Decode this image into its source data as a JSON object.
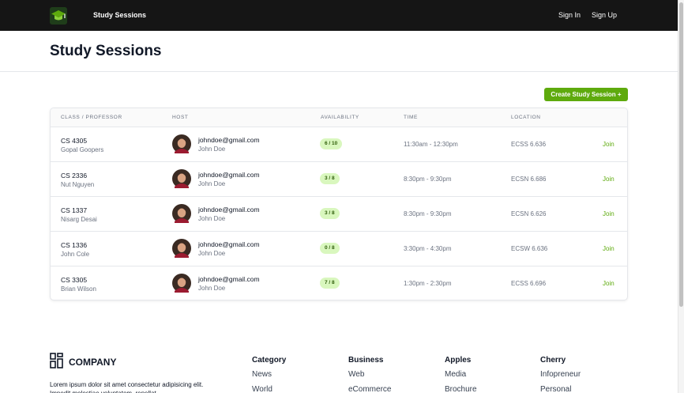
{
  "nav": {
    "brand": "Study Sessions",
    "sign_in": "Sign In",
    "sign_up": "Sign Up"
  },
  "header": {
    "title": "Study Sessions"
  },
  "actions": {
    "create_label": "Create Study Session +"
  },
  "table": {
    "headers": {
      "class_professor": "CLASS / PROFESSOR",
      "host": "HOST",
      "availability": "AVAILABILITY",
      "time": "TIME",
      "location": "LOCATION"
    },
    "rows": [
      {
        "class": "CS 4305",
        "professor": "Gopal Goopers",
        "email": "johndoe@gmail.com",
        "host": "John Doe",
        "availability": "6 / 10",
        "time": "11:30am - 12:30pm",
        "location": "ECSS 6.636",
        "action": "Join"
      },
      {
        "class": "CS 2336",
        "professor": "Nut Nguyen",
        "email": "johndoe@gmail.com",
        "host": "John Doe",
        "availability": "3 / 8",
        "time": "8:30pm - 9:30pm",
        "location": "ECSN 6.686",
        "action": "Join"
      },
      {
        "class": "CS 1337",
        "professor": "Nisarg Desai",
        "email": "johndoe@gmail.com",
        "host": "John Doe",
        "availability": "3 / 8",
        "time": "8:30pm - 9:30pm",
        "location": "ECSN 6.626",
        "action": "Join"
      },
      {
        "class": "CS 1336",
        "professor": "John Cole",
        "email": "johndoe@gmail.com",
        "host": "John Doe",
        "availability": "0 / 8",
        "time": "3:30pm - 4:30pm",
        "location": "ECSW 6.636",
        "action": "Join"
      },
      {
        "class": "CS 3305",
        "professor": "Brian Wilson",
        "email": "johndoe@gmail.com",
        "host": "John Doe",
        "availability": "7 / 8",
        "time": "1:30pm - 2:30pm",
        "location": "ECSS 6.696",
        "action": "Join"
      }
    ]
  },
  "footer": {
    "company": "COMPANY",
    "description": "Lorem ipsum dolor sit amet consectetur adipisicing elit. Impedit molestiae voluptatem, repellat",
    "columns": [
      {
        "title": "Category",
        "links": [
          "News",
          "World"
        ]
      },
      {
        "title": "Business",
        "links": [
          "Web",
          "eCommerce"
        ]
      },
      {
        "title": "Apples",
        "links": [
          "Media",
          "Brochure"
        ]
      },
      {
        "title": "Cherry",
        "links": [
          "Infopreneur",
          "Personal"
        ]
      }
    ]
  },
  "colors": {
    "accent": "#5eaa0d",
    "navbar": "#151515",
    "badge_bg": "#d9f7be",
    "badge_text": "#2f5d0a"
  },
  "icons": {
    "logo": "graduation-cap-icon",
    "footer_logo": "grid-logo-icon",
    "avatar": "user-avatar"
  }
}
